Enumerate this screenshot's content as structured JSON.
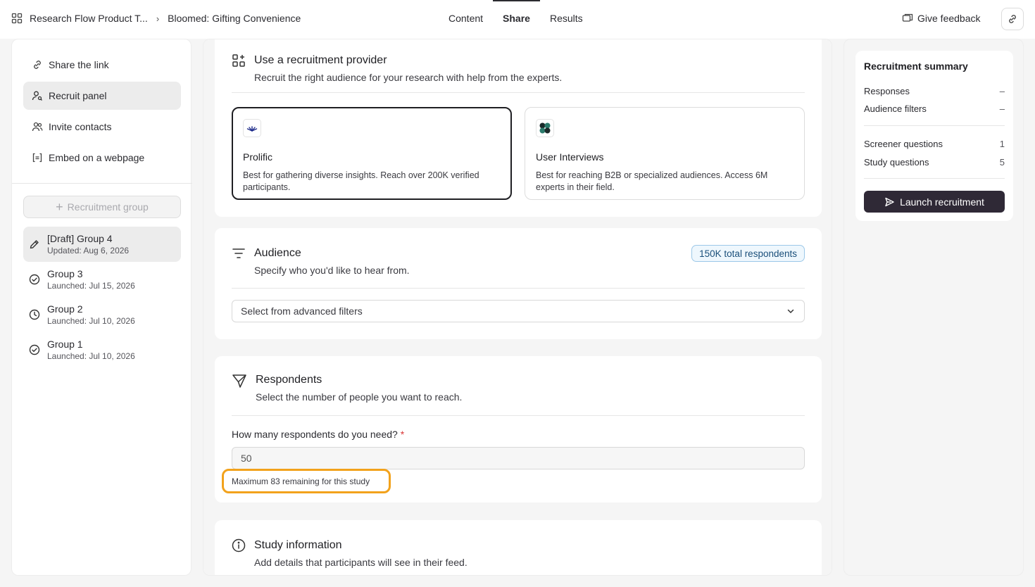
{
  "header": {
    "breadcrumb_project": "Research Flow Product T...",
    "breadcrumb_sep": "›",
    "breadcrumb_study": "Bloomed: Gifting Convenience",
    "tabs": [
      {
        "label": "Content"
      },
      {
        "label": "Share"
      },
      {
        "label": "Results"
      }
    ],
    "active_tab": "Share",
    "feedback_label": "Give feedback"
  },
  "sidebar": {
    "items": [
      {
        "label": "Share the link",
        "icon": "link-icon"
      },
      {
        "label": "Recruit panel",
        "icon": "user-search-icon"
      },
      {
        "label": "Invite contacts",
        "icon": "users-icon"
      },
      {
        "label": "Embed on a webpage",
        "icon": "embed-icon"
      }
    ],
    "active_item": "Recruit panel",
    "new_group_label": "Recruitment group",
    "groups": [
      {
        "title": "[Draft] Group 4",
        "subtitle": "Updated: Aug 6, 2026",
        "icon": "pencil-icon"
      },
      {
        "title": "Group 3",
        "subtitle": "Launched: Jul 15, 2026",
        "icon": "check-circle-icon"
      },
      {
        "title": "Group 2",
        "subtitle": "Launched: Jul 10, 2026",
        "icon": "clock-icon"
      },
      {
        "title": "Group 1",
        "subtitle": "Launched: Jul 10, 2026",
        "icon": "check-circle-icon"
      }
    ]
  },
  "provider_section": {
    "title": "Use a recruitment provider",
    "description": "Recruit the right audience for your research with help from the experts.",
    "providers": [
      {
        "name": "Prolific",
        "description": "Best for gathering diverse insights. Reach over 200K verified participants.",
        "selected": true
      },
      {
        "name": "User Interviews",
        "description": "Best for reaching B2B or specialized audiences. Access 6M experts in their field.",
        "selected": false
      }
    ]
  },
  "audience_section": {
    "title": "Audience",
    "description": "Specify who you'd like to hear from.",
    "badge": "150K total respondents",
    "select_label": "Select from advanced filters"
  },
  "respondents_section": {
    "title": "Respondents",
    "description": "Select the number of people you want to reach.",
    "field_label": "How many respondents do you need?",
    "required_mark": "*",
    "value": "50",
    "hint": "Maximum 83 remaining for this study"
  },
  "study_info_section": {
    "title": "Study information",
    "description": "Add details that participants will see in their feed."
  },
  "summary": {
    "title": "Recruitment summary",
    "rows_top": [
      {
        "label": "Responses",
        "value": "–"
      },
      {
        "label": "Audience filters",
        "value": "–"
      }
    ],
    "rows_bottom": [
      {
        "label": "Screener questions",
        "value": "1"
      },
      {
        "label": "Study questions",
        "value": "5"
      }
    ],
    "launch_label": "Launch recruitment"
  },
  "colors": {
    "accent_dark": "#2f2936",
    "highlight": "#f2a21c",
    "badge_bg": "#eef7fd",
    "badge_border": "#9cc8e8"
  }
}
